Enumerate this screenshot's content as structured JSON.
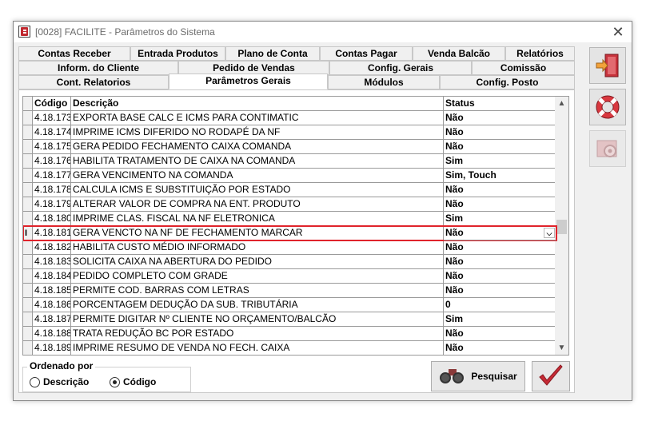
{
  "window": {
    "title": "[0028] FACILITE - Parâmetros do Sistema",
    "close_glyph": "✕"
  },
  "tabs": {
    "row1": [
      "Contas Receber",
      "Entrada Produtos",
      "Plano de Conta",
      "Contas Pagar",
      "Venda Balcão",
      "Relatórios"
    ],
    "row2": [
      "Inform. do Cliente",
      "Pedido de Vendas",
      "Config. Gerais",
      "Comissão"
    ],
    "row3": [
      "Cont. Relatorios",
      "Parâmetros Gerais",
      "Módulos",
      "Config. Posto"
    ],
    "active": "Parâmetros Gerais"
  },
  "grid": {
    "headers": {
      "code": "Código",
      "desc": "Descrição",
      "status": "Status"
    },
    "selected_indicator": "I",
    "rows": [
      {
        "code": "4.18.173",
        "desc": "EXPORTA BASE CALC E ICMS PARA CONTIMATIC",
        "status": "Não"
      },
      {
        "code": "4.18.174",
        "desc": "IMPRIME ICMS DIFERIDO NO RODAPÉ DA NF",
        "status": "Não"
      },
      {
        "code": "4.18.175",
        "desc": "GERA PEDIDO FECHAMENTO CAIXA COMANDA",
        "status": "Não"
      },
      {
        "code": "4.18.176",
        "desc": "HABILITA TRATAMENTO DE CAIXA NA COMANDA",
        "status": "Sim"
      },
      {
        "code": "4.18.177",
        "desc": "GERA VENCIMENTO NA COMANDA",
        "status": "Sim, Touch"
      },
      {
        "code": "4.18.178",
        "desc": "CALCULA ICMS E SUBSTITUIÇÃO POR ESTADO",
        "status": "Não"
      },
      {
        "code": "4.18.179",
        "desc": "ALTERAR VALOR DE COMPRA NA ENT. PRODUTO",
        "status": "Não"
      },
      {
        "code": "4.18.180",
        "desc": "IMPRIME CLAS. FISCAL NA NF ELETRONICA",
        "status": "Sim"
      },
      {
        "code": "4.18.181",
        "desc": "GERA VENCTO NA NF DE FECHAMENTO MARCAR",
        "status": "Não",
        "selected": true
      },
      {
        "code": "4.18.182",
        "desc": "HABILITA CUSTO MÉDIO INFORMADO",
        "status": "Não"
      },
      {
        "code": "4.18.183",
        "desc": "SOLICITA CAIXA NA ABERTURA DO PEDIDO",
        "status": "Não"
      },
      {
        "code": "4.18.184",
        "desc": "PEDIDO COMPLETO COM GRADE",
        "status": "Não"
      },
      {
        "code": "4.18.185",
        "desc": "PERMITE COD. BARRAS COM LETRAS",
        "status": "Não"
      },
      {
        "code": "4.18.186",
        "desc": "PORCENTAGEM DEDUÇÃO DA SUB. TRIBUTÁRIA",
        "status": "0"
      },
      {
        "code": "4.18.187",
        "desc": "PERMITE DIGITAR Nº CLIENTE NO ORÇAMENTO/BALCÃO",
        "status": "Sim"
      },
      {
        "code": "4.18.188",
        "desc": "TRATA REDUÇÃO BC POR ESTADO",
        "status": "Não"
      },
      {
        "code": "4.18.189",
        "desc": "IMPRIME RESUMO DE VENDA NO FECH. CAIXA",
        "status": "Não"
      }
    ]
  },
  "order": {
    "legend": "Ordenado por",
    "options": [
      "Descrição",
      "Código"
    ],
    "selected": "Código"
  },
  "buttons": {
    "search_label": "Pesquisar"
  },
  "side_buttons": [
    "exit-door-icon",
    "lifebuoy-help-icon",
    "settings-gears-icon"
  ]
}
